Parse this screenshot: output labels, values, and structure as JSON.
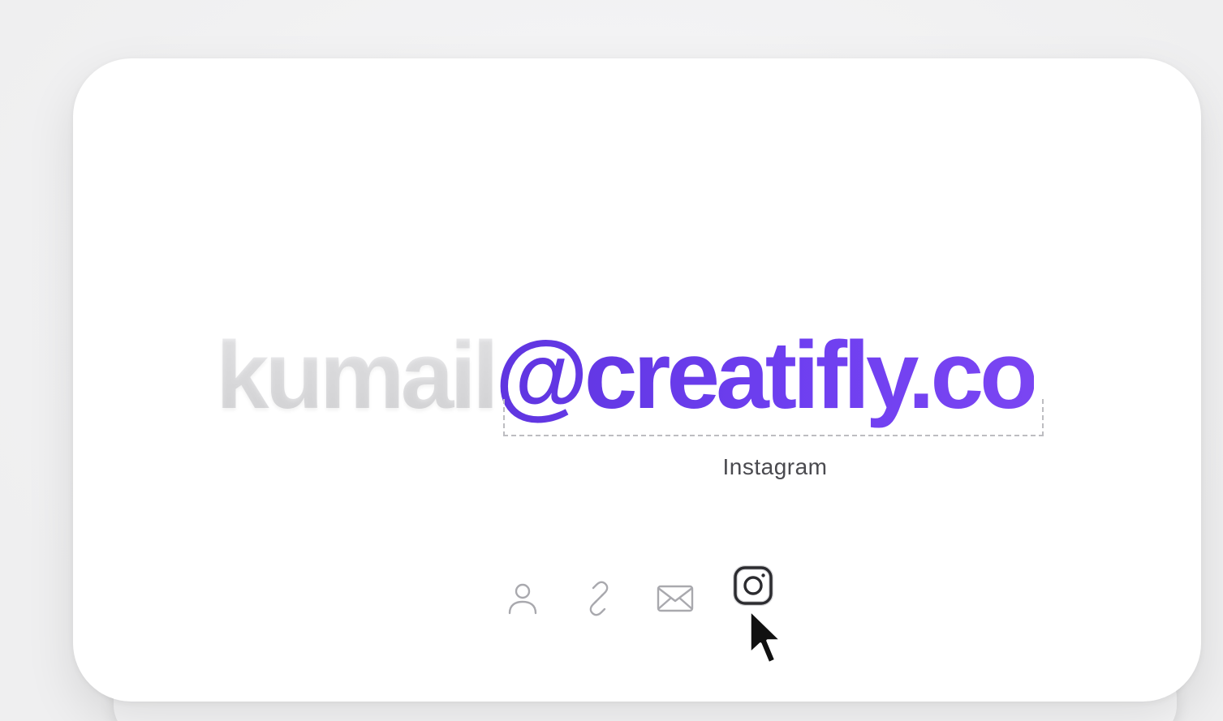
{
  "email": {
    "username": "kumail",
    "domain": "@creatifly.co"
  },
  "tooltip": {
    "label": "Instagram"
  },
  "icons": [
    {
      "name": "user-icon",
      "active": false
    },
    {
      "name": "link-icon",
      "active": false
    },
    {
      "name": "mail-icon",
      "active": false
    },
    {
      "name": "instagram-icon",
      "active": true
    }
  ],
  "colors": {
    "accent": "#6a3ae6",
    "muted_text": "#e6e6e8",
    "icon_inactive": "#a9a9ae",
    "icon_active": "#2b2b2f"
  }
}
